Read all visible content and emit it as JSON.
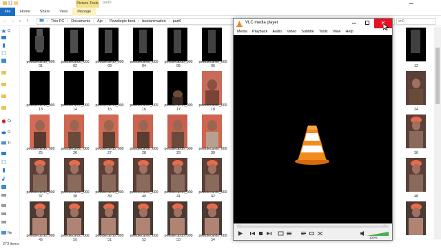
{
  "explorer": {
    "contextual_tab": "Picture Tools",
    "window_title": "part0",
    "tabs": [
      "File",
      "Home",
      "Share",
      "View",
      "Manage"
    ],
    "breadcrumb": [
      "This PC",
      "Documents",
      "Ajo",
      "Pewdiepie boot",
      "bootanimation",
      "part0"
    ],
    "search_placeholder": "art0",
    "status": "273 items",
    "nav_items": [
      "Q",
      "",
      "",
      "",
      "",
      "",
      "Cr",
      "O",
      "Tr",
      "",
      "",
      "",
      "",
      "",
      "",
      "",
      "",
      "Ne"
    ]
  },
  "thumbnails": {
    "labels": [
      [
        "pewdiecardo_000\n01",
        "pewdiecardo_000\n02",
        "pewdiecardo_000\n03",
        "pewdiecardo_000\n04",
        "pewdiecardo_000\n05",
        "pewdiecardo_000\n06"
      ],
      [
        "pewdiecardo_000\n13",
        "pewdiecardo_000\n14",
        "pewdiecardo_000\n15",
        "pewdiecardo_000\n16",
        "pewdiecardo_000\n17",
        "pewdiecardo_000\n18"
      ],
      [
        "pewdiecardo_000\n25",
        "pewdiecardo_000\n26",
        "pewdiecardo_000\n27",
        "pewdiecardo_000\n28",
        "pewdiecardo_000\n29",
        "pewdiecardo_000\n30"
      ],
      [
        "pewdiecardo_000\n37",
        "pewdiecardo_000\n38",
        "pewdiecardo_000\n39",
        "pewdiecardo_000\n40",
        "pewdiecardo_000\n41",
        "pewdiecardo_000\n42"
      ],
      [
        "pewdiecardo_000\n49",
        "pewdiecardo_000\n50",
        "pewdiecardo_000\n51",
        "pewdiecardo_000\n52",
        "pewdiecardo_000\n53",
        "pewdiecardo_000\n54"
      ]
    ],
    "right_labels": [
      "12",
      "24",
      "36",
      "48"
    ]
  },
  "vlc": {
    "title": "VLC media player",
    "menu": [
      "Media",
      "Playback",
      "Audio",
      "Video",
      "Subtitle",
      "Tools",
      "View",
      "Help"
    ],
    "time_elapsed": "--:--",
    "time_total": "--:--",
    "volume": "100%",
    "accent": "#f0821e",
    "close_color": "#e81123"
  },
  "colors": {
    "file_tab": "#1a6dc2",
    "picture_tools": "#f5e08a"
  }
}
